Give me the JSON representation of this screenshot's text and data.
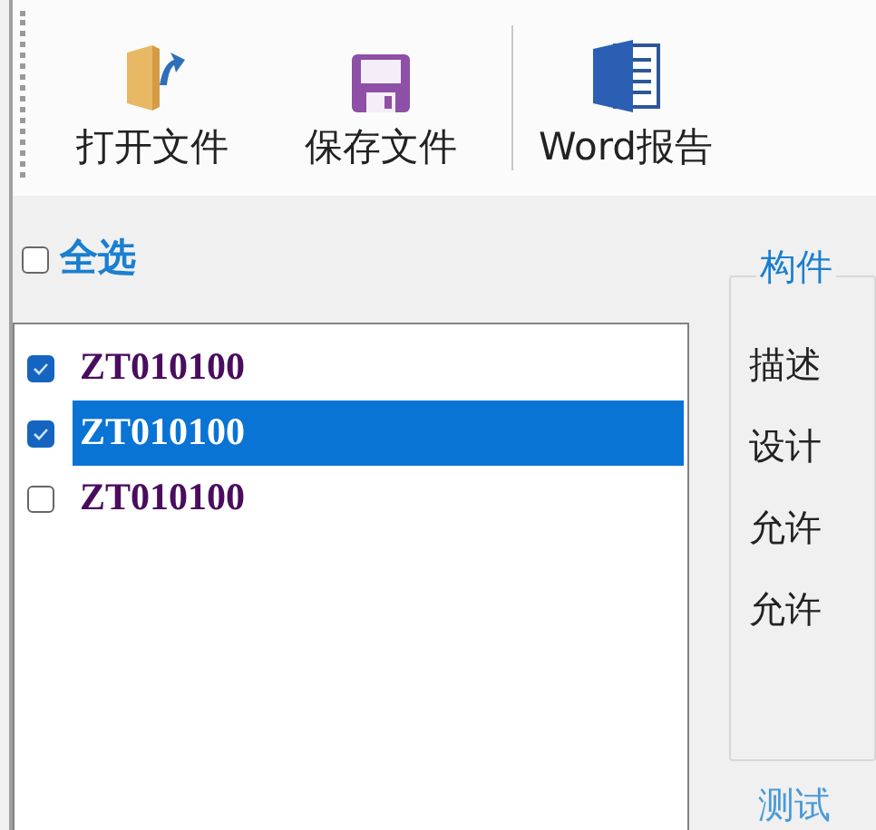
{
  "toolbar": {
    "buttons": [
      {
        "label": "打开文件",
        "kind": "open"
      },
      {
        "label": "保存文件",
        "kind": "save"
      },
      {
        "label": "Word报告",
        "kind": "word"
      }
    ]
  },
  "select_all": {
    "label": "全选",
    "checked": false
  },
  "list": {
    "items": [
      {
        "label": "ZT010100",
        "checked": true,
        "selected": false
      },
      {
        "label": "ZT010100",
        "checked": true,
        "selected": true
      },
      {
        "label": "ZT010100",
        "checked": false,
        "selected": false
      }
    ]
  },
  "group": {
    "title": "构件",
    "labels": [
      "描述",
      "设计",
      "允许",
      "允许"
    ]
  },
  "next_group": {
    "title": "测试"
  }
}
